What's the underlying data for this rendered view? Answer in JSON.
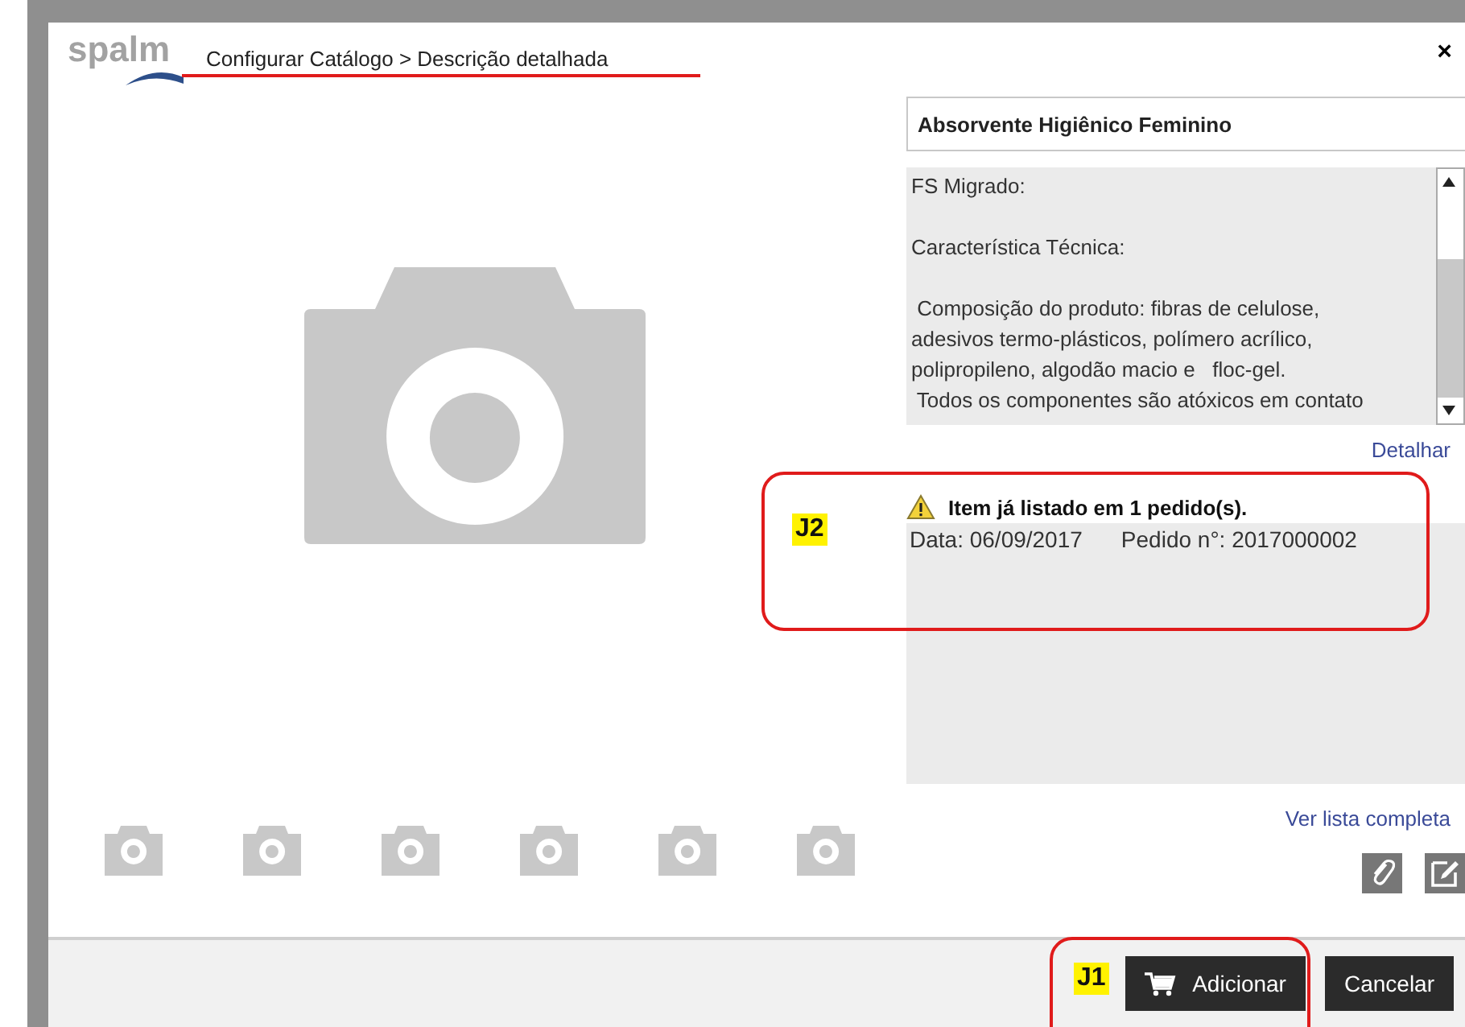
{
  "window": {
    "logo": "spalm",
    "title": "Configurar Catálogo > Descrição detalhada",
    "close": "×"
  },
  "product": {
    "name": "Absorvente Higiênico Feminino",
    "description": "FS Migrado:\n\nCaracterística Técnica:\n\n Composição do produto: fibras de celulose,\nadesivos termo-plásticos, polímero acrílico,\npolipropileno, algodão macio e   floc-gel.\n Todos os componentes são atóxicos em contato",
    "detail_link": "Detalhar"
  },
  "alert": {
    "message": "Item já listado em 1 pedido(s).",
    "orders": [
      {
        "date": "Data: 06/09/2017",
        "order": "Pedido n°: 2017000002"
      }
    ],
    "view_all": "Ver lista completa"
  },
  "buttons": [
    {
      "label": "Adicionar",
      "kind": "add"
    },
    {
      "label": "Cancelar",
      "kind": "cancel"
    }
  ],
  "annotations": [
    {
      "label": "J2",
      "kind": "alert"
    },
    {
      "label": "J1",
      "kind": "button"
    }
  ]
}
